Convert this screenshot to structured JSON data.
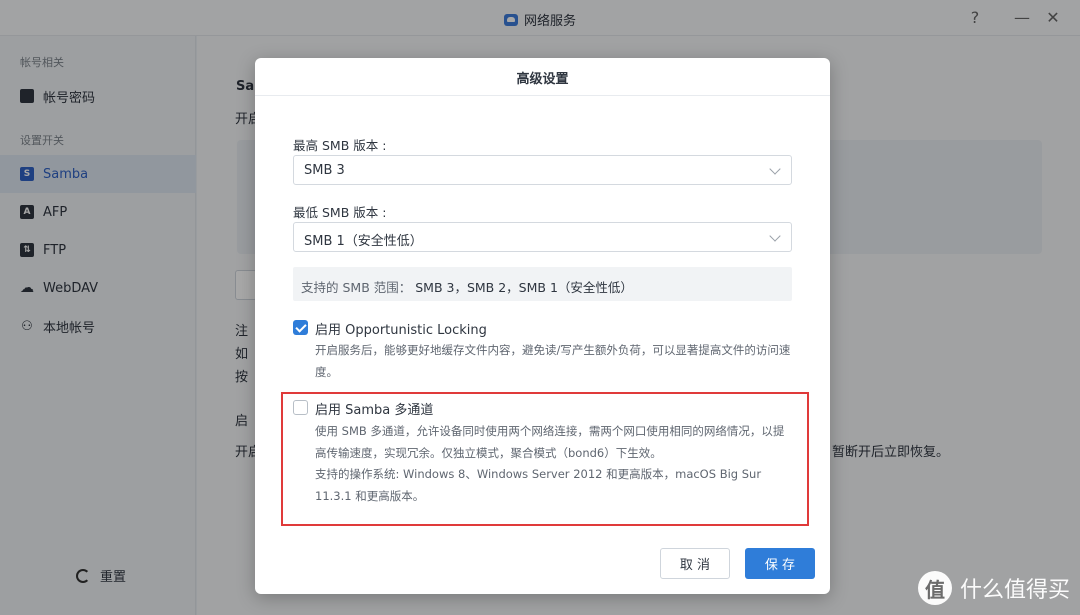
{
  "window": {
    "title": "网络服务",
    "help": "?",
    "minimize": "—",
    "close": "✕"
  },
  "sidebar": {
    "group_account": "帐号相关",
    "group_settings": "设置开关",
    "items": [
      {
        "label": "帐号密码",
        "icon": "account-card-icon",
        "glyph": ""
      },
      {
        "label": "Samba",
        "icon": "samba-icon",
        "glyph": "S"
      },
      {
        "label": "AFP",
        "icon": "afp-icon",
        "glyph": "A"
      },
      {
        "label": "FTP",
        "icon": "ftp-icon",
        "glyph": "⇅"
      },
      {
        "label": "WebDAV",
        "icon": "cloud-icon",
        "glyph": "☁"
      },
      {
        "label": "本地帐号",
        "icon": "user-tree-icon",
        "glyph": "⚇"
      }
    ],
    "reset": "重置"
  },
  "content": {
    "frag_sa": "Sa",
    "frag_kai1": "开启",
    "frag_zhu": "注",
    "frag_ru": "如",
    "frag_an": "按",
    "frag_qi": "启",
    "frag_kai2": "开启",
    "frag_tail": "暂断开后立即恢复。"
  },
  "modal": {
    "title": "高级设置",
    "max_label": "最高 SMB 版本 :",
    "max_value": "SMB 3",
    "min_label": "最低 SMB 版本 :",
    "min_value": "SMB 1（安全性低）",
    "range_label": "支持的 SMB 范围：",
    "range_value": "SMB 3，SMB 2，SMB 1（安全性低）",
    "oplock_label": "启用 Opportunistic Locking",
    "oplock_checked": true,
    "oplock_desc": "开启服务后，能够更好地缓存文件内容，避免读/写产生额外负荷，可以显著提高文件的访问速度。",
    "multichannel_label": "启用 Samba 多通道",
    "multichannel_checked": false,
    "multichannel_desc1": "使用 SMB 多通道，允许设备同时使用两个网络连接，需两个网口使用相同的网络情况，以提高传输速度，实现冗余。仅独立模式，聚合模式（bond6）下生效。",
    "multichannel_desc2": "支持的操作系统: Windows 8、Windows Server 2012 和更高版本，macOS Big Sur 11.3.1 和更高版本。",
    "cancel": "取 消",
    "save": "保 存"
  },
  "watermark": {
    "logo": "值",
    "text": "什么值得买"
  },
  "colors": {
    "accent": "#2f7dd9",
    "highlight": "#e03a3a"
  }
}
